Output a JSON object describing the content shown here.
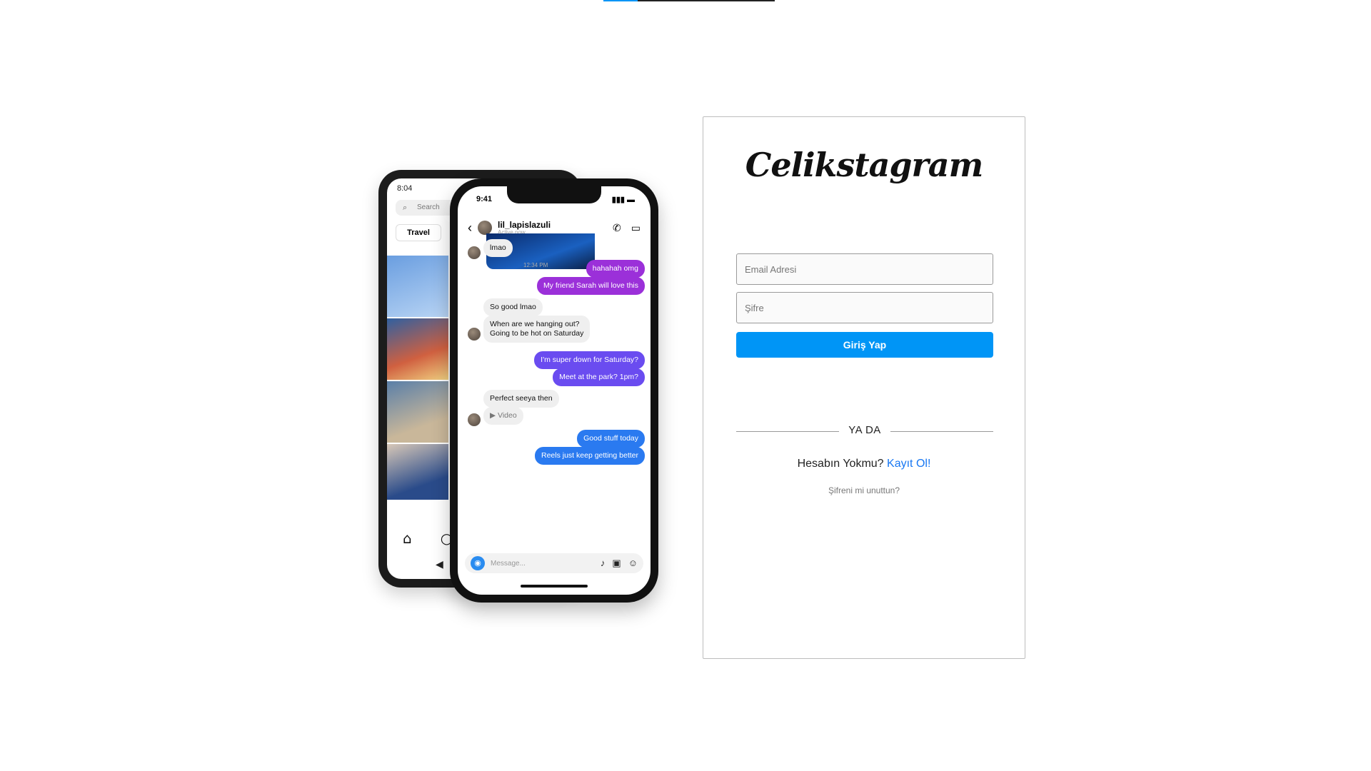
{
  "top_progress": {
    "fraction": 0.2
  },
  "phone_back": {
    "status_time": "8:04",
    "search_placeholder": "Search",
    "chip_label": "Travel"
  },
  "phone_front": {
    "status_time": "9:41",
    "chat_username": "lil_lapislazuli",
    "chat_status": "Active now",
    "timestamp": "12:34 PM",
    "messages": [
      {
        "dir": "in",
        "text": "lmao"
      },
      {
        "dir": "out",
        "text": "hahahah omg"
      },
      {
        "dir": "out",
        "text": "My friend Sarah will love this"
      },
      {
        "dir": "in",
        "text": "So good lmao"
      },
      {
        "dir": "in",
        "text": "When are we hanging out?"
      },
      {
        "dir": "in",
        "text": "Going to be hot on Saturday"
      },
      {
        "dir": "out",
        "text": "I'm super down for Saturday?"
      },
      {
        "dir": "out",
        "text": "Meet at the park? 1pm?"
      },
      {
        "dir": "in",
        "text": "Perfect seeya then"
      },
      {
        "dir": "in",
        "text": "Video"
      },
      {
        "dir": "out",
        "text": "Good stuff today"
      },
      {
        "dir": "out",
        "text": "Reels just keep getting better"
      }
    ],
    "compose_placeholder": "Message..."
  },
  "login": {
    "logo": "Celikstagram",
    "email_placeholder": "Email Adresi",
    "password_placeholder": "Şifre",
    "login_button": "Giriş Yap",
    "divider_text": "YA DA",
    "no_account_text": "Hesabın Yokmu?",
    "signup_link": "Kayıt Ol!",
    "forgot_password": "Şifreni mi unuttun?"
  },
  "colors": {
    "accent": "#0095f6",
    "link": "#1877f2"
  }
}
